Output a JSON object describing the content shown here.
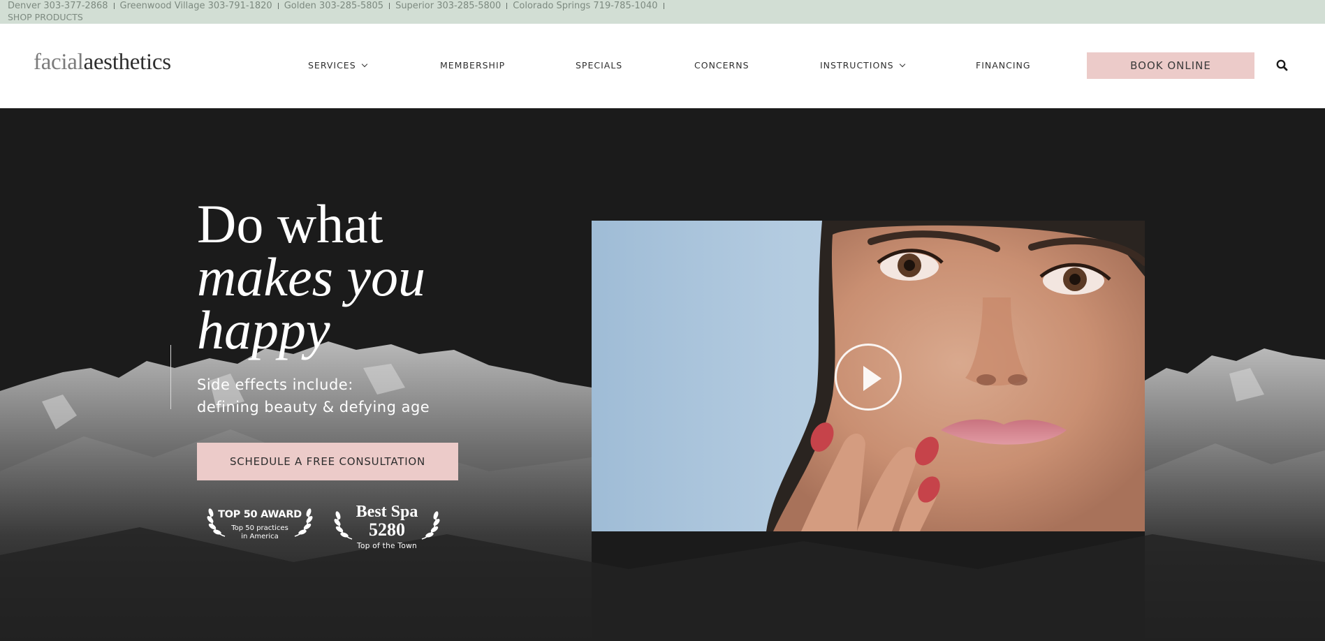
{
  "topbar": {
    "phones": [
      "Denver 303-377-2868",
      "Greenwood Village 303-791-1820",
      "Golden 303-285-5805",
      "Superior 303-285-5800",
      "Colorado Springs 719-785-1040"
    ],
    "shop": "SHOP PRODUCTS"
  },
  "header": {
    "logo_part1": "facial",
    "logo_part2": "aesthetics",
    "nav": {
      "services": "SERVICES",
      "membership": "MEMBERSHIP",
      "specials": "SPECIALS",
      "concerns": "CONCERNS",
      "instructions": "INSTRUCTIONS",
      "financing": "FINANCING"
    },
    "book": "BOOK ONLINE",
    "search_icon": "search-icon"
  },
  "hero": {
    "headline_line1": "Do what",
    "headline_line2": "makes you",
    "headline_line3": "happy",
    "sub_line1": "Side effects include:",
    "sub_line2": "defining beauty & defying age",
    "cta": "SCHEDULE A FREE CONSULTATION",
    "badge1_title": "TOP 50 AWARD",
    "badge1_line1": "Top 50 practices",
    "badge1_line2": "in America",
    "badge2_title": "Best Spa",
    "badge2_number": "5280",
    "badge2_sub": "Top of the Town",
    "play_icon": "play-icon"
  },
  "colors": {
    "topbar_bg": "#d2ded4",
    "hero_bg": "#1b1b1b",
    "accent_pink": "#eccbc9"
  }
}
